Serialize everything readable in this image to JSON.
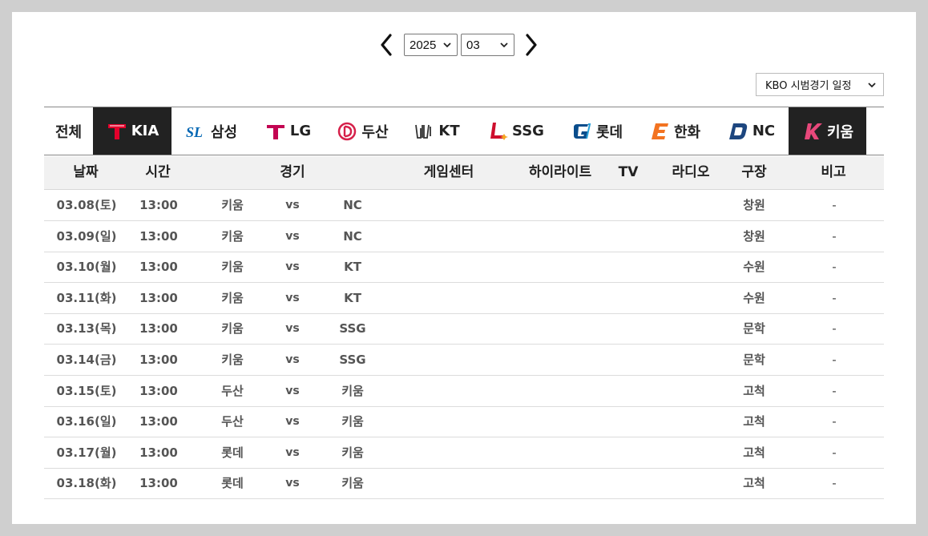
{
  "nav": {
    "year": "2025",
    "month": "03",
    "series_select": "KBO 시범경기 일정"
  },
  "tabs": [
    {
      "label": "전체",
      "logo": null,
      "color": null,
      "dark": false
    },
    {
      "label": "KIA",
      "logo": "kia-logo-icon",
      "color": "#e4002b",
      "dark": true
    },
    {
      "label": "삼성",
      "logo": "samsung-logo-icon",
      "color": "#0066b3",
      "dark": false
    },
    {
      "label": "LG",
      "logo": "lg-logo-icon",
      "color": "#c30452",
      "dark": false
    },
    {
      "label": "두산",
      "logo": "doosan-logo-icon",
      "color": "#d6204a",
      "dark": false
    },
    {
      "label": "KT",
      "logo": "kt-logo-icon",
      "color": "#333333",
      "dark": false
    },
    {
      "label": "SSG",
      "logo": "ssg-logo-icon",
      "color": "#ce0e2d",
      "dark": false
    },
    {
      "label": "롯데",
      "logo": "lotte-logo-icon",
      "color": "#0a4d8c",
      "dark": false
    },
    {
      "label": "한화",
      "logo": "hanwha-logo-icon",
      "color": "#f37321",
      "dark": false
    },
    {
      "label": "NC",
      "logo": "nc-logo-icon",
      "color": "#1d467f",
      "dark": false
    },
    {
      "label": "키움",
      "logo": "kiwoom-logo-icon",
      "color": "#e8487b",
      "dark": true
    }
  ],
  "table": {
    "headers": [
      "날짜",
      "시간",
      "경기",
      "게임센터",
      "하이라이트",
      "TV",
      "라디오",
      "구장",
      "비고"
    ],
    "rows": [
      {
        "date": "03.08(토)",
        "time": "13:00",
        "away": "키움",
        "vs": "vs",
        "home": "NC",
        "venue": "창원",
        "note": "-"
      },
      {
        "date": "03.09(일)",
        "time": "13:00",
        "away": "키움",
        "vs": "vs",
        "home": "NC",
        "venue": "창원",
        "note": "-"
      },
      {
        "date": "03.10(월)",
        "time": "13:00",
        "away": "키움",
        "vs": "vs",
        "home": "KT",
        "venue": "수원",
        "note": "-"
      },
      {
        "date": "03.11(화)",
        "time": "13:00",
        "away": "키움",
        "vs": "vs",
        "home": "KT",
        "venue": "수원",
        "note": "-"
      },
      {
        "date": "03.13(목)",
        "time": "13:00",
        "away": "키움",
        "vs": "vs",
        "home": "SSG",
        "venue": "문학",
        "note": "-"
      },
      {
        "date": "03.14(금)",
        "time": "13:00",
        "away": "키움",
        "vs": "vs",
        "home": "SSG",
        "venue": "문학",
        "note": "-"
      },
      {
        "date": "03.15(토)",
        "time": "13:00",
        "away": "두산",
        "vs": "vs",
        "home": "키움",
        "venue": "고척",
        "note": "-"
      },
      {
        "date": "03.16(일)",
        "time": "13:00",
        "away": "두산",
        "vs": "vs",
        "home": "키움",
        "venue": "고척",
        "note": "-"
      },
      {
        "date": "03.17(월)",
        "time": "13:00",
        "away": "롯데",
        "vs": "vs",
        "home": "키움",
        "venue": "고척",
        "note": "-"
      },
      {
        "date": "03.18(화)",
        "time": "13:00",
        "away": "롯데",
        "vs": "vs",
        "home": "키움",
        "venue": "고척",
        "note": "-"
      }
    ]
  }
}
